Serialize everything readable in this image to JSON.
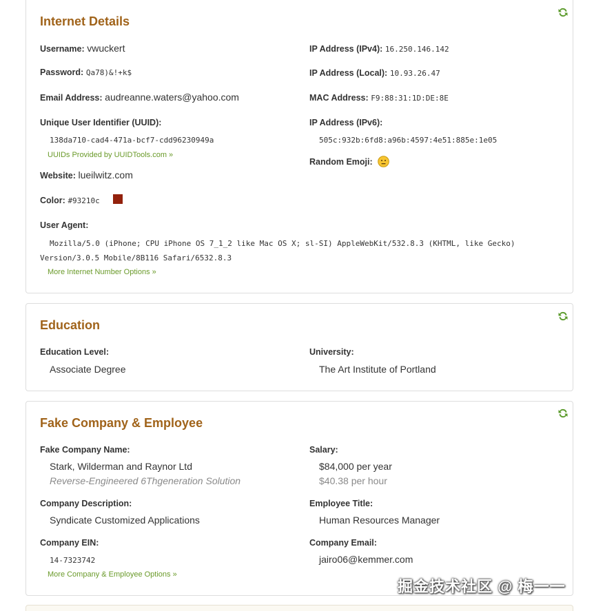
{
  "internet": {
    "title": "Internet Details",
    "username_label": "Username:",
    "username": "vwuckert",
    "password_label": "Password:",
    "password": "Qa78)&!+k$",
    "email_label": "Email Address:",
    "email": "audreanne.waters@yahoo.com",
    "uuid_label": "Unique User Identifier (UUID):",
    "uuid": "138da710-cad4-471a-bcf7-cdd96230949a",
    "uuid_link": "UUIDs Provided by UUIDTools.com »",
    "website_label": "Website:",
    "website": "lueilwitz.com",
    "color_label": "Color:",
    "color": "#93210c",
    "user_agent_label": "User Agent:",
    "user_agent": "Mozilla/5.0 (iPhone; CPU iPhone OS 7_1_2 like Mac OS X; sl-SI) AppleWebKit/532.8.3 (KHTML, like Gecko) Version/3.0.5 Mobile/8B116 Safari/6532.8.3",
    "more_link": "More Internet Number Options »",
    "ipv4_label": "IP Address (IPv4):",
    "ipv4": "16.250.146.142",
    "local_label": "IP Address (Local):",
    "local": "10.93.26.47",
    "mac_label": "MAC Address:",
    "mac": "F9:88:31:1D:DE:8E",
    "ipv6_label": "IP Address (IPv6):",
    "ipv6": "505c:932b:6fd8:a96b:4597:4e51:885e:1e05",
    "emoji_label": "Random Emoji:",
    "emoji_icon": "neutral-face-emoji"
  },
  "education": {
    "title": "Education",
    "level_label": "Education Level:",
    "level": "Associate Degree",
    "university_label": "University:",
    "university": "The Art Institute of Portland"
  },
  "company": {
    "title": "Fake Company & Employee",
    "name_label": "Fake Company Name:",
    "name": "Stark, Wilderman and Raynor Ltd",
    "slogan": "Reverse-Engineered 6Thgeneration Solution",
    "description_label": "Company Description:",
    "description": "Syndicate Customized Applications",
    "ein_label": "Company EIN:",
    "ein": "14-7323742",
    "more_link": "More Company & Employee Options »",
    "salary_label": "Salary:",
    "salary_year": "$84,000 per year",
    "salary_hour": "$40.38 per hour",
    "title_label": "Employee Title:",
    "employee_title": "Human Resources Manager",
    "email_label": "Company Email:",
    "email": "jairo06@kemmer.com"
  },
  "watermark": "掘金技术社区 @ 梅一一",
  "colors": {
    "heading": "#a0631a",
    "link": "#6a9a2a",
    "refresh": "#5a9a2a",
    "swatch": "#93210c"
  }
}
